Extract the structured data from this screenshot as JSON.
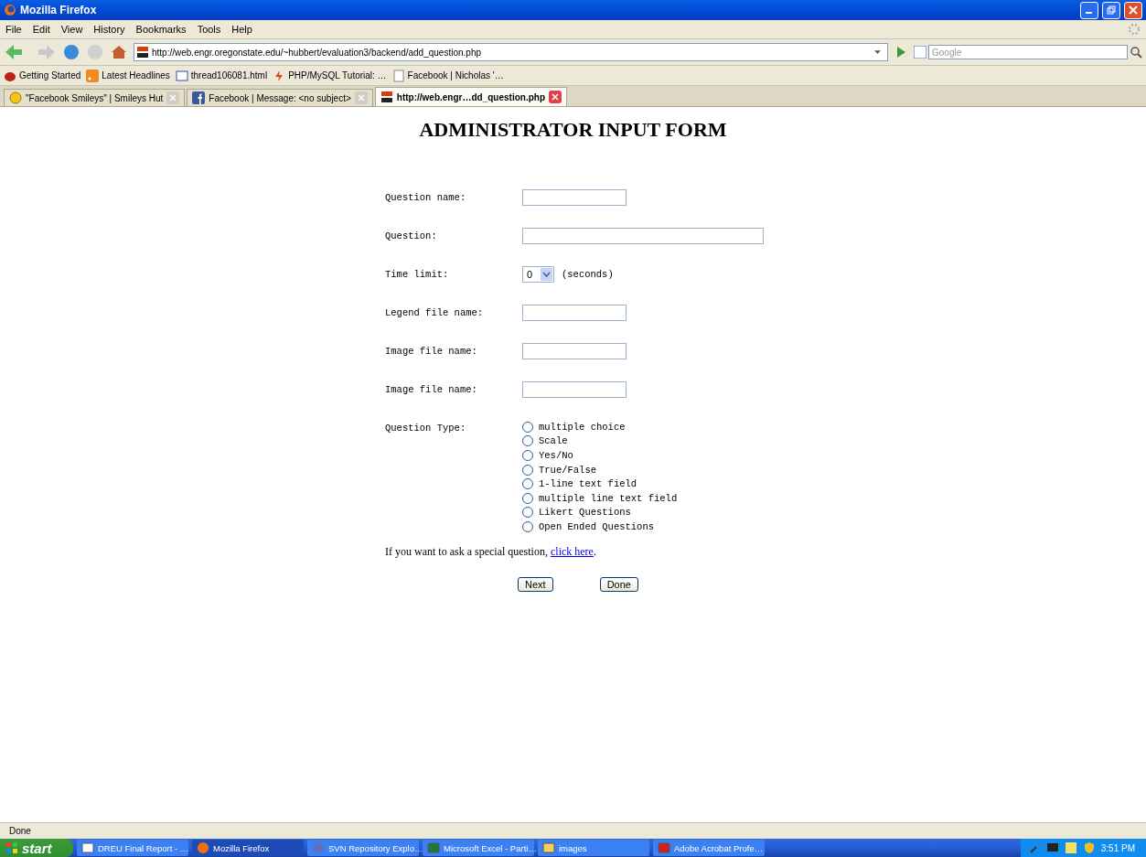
{
  "window": {
    "title": "Mozilla Firefox"
  },
  "menu": [
    "File",
    "Edit",
    "View",
    "History",
    "Bookmarks",
    "Tools",
    "Help"
  ],
  "address": {
    "url": "http://web.engr.oregonstate.edu/~hubbert/evaluation3/backend/add_question.php"
  },
  "search": {
    "placeholder": "Google"
  },
  "bookmarks": [
    {
      "label": "Getting Started",
      "kind": "bug"
    },
    {
      "label": "Latest Headlines",
      "kind": "feed"
    },
    {
      "label": "thread106081.html",
      "kind": "db"
    },
    {
      "label": "PHP/MySQL Tutorial: …",
      "kind": "php"
    },
    {
      "label": "Facebook | Nicholas '…",
      "kind": "page"
    }
  ],
  "tabs": [
    {
      "label": "\"Facebook Smileys\" | Smileys Hut",
      "kind": "smiley",
      "selected": false
    },
    {
      "label": "Facebook | Message: <no subject>",
      "kind": "facebook",
      "selected": false
    },
    {
      "label": "http://web.engr…dd_question.php",
      "kind": "osu",
      "selected": true
    }
  ],
  "page": {
    "title": "ADMINISTRATOR INPUT FORM",
    "fields": [
      {
        "label": "Question name:",
        "kind": "text"
      },
      {
        "label": "Question:",
        "kind": "wide"
      },
      {
        "label": "Time limit:",
        "kind": "select",
        "value": "0",
        "suffix": "(seconds)"
      },
      {
        "label": "Legend file name:",
        "kind": "text"
      },
      {
        "label": "Image file name:",
        "kind": "text"
      },
      {
        "label": "Image file name:",
        "kind": "text"
      }
    ],
    "question_type": {
      "label": "Question Type:",
      "options": [
        {
          "label": "multiple choice",
          "selected": false
        },
        {
          "label": "Scale",
          "selected": false
        },
        {
          "label": "Yes/No",
          "selected": false
        },
        {
          "label": "True/False",
          "selected": false
        },
        {
          "label": "1-line text field",
          "selected": false
        },
        {
          "label": "multiple line text field",
          "selected": false
        },
        {
          "label": "Likert Questions",
          "selected": false
        },
        {
          "label": "Open Ended Questions",
          "selected": false
        }
      ]
    },
    "special": {
      "text": "If you want to ask a special question,",
      "link": "click here",
      "end": "."
    },
    "buttons": [
      "Next",
      "Done"
    ]
  },
  "status": "Done",
  "taskbar": {
    "start": "start",
    "items": [
      {
        "label": "DREU Final Report - …",
        "kind": "word",
        "selected": false
      },
      {
        "label": "Mozilla Firefox",
        "kind": "firefox",
        "selected": true
      },
      {
        "label": "SVN Repository Explo…",
        "kind": "svn",
        "selected": false
      },
      {
        "label": "Microsoft Excel - Parti…",
        "kind": "excel",
        "selected": false
      },
      {
        "label": "images",
        "kind": "folder",
        "selected": false
      },
      {
        "label": "Adobe Acrobat Profe…",
        "kind": "acrobat",
        "selected": false
      }
    ],
    "clock": "3:51 PM"
  }
}
